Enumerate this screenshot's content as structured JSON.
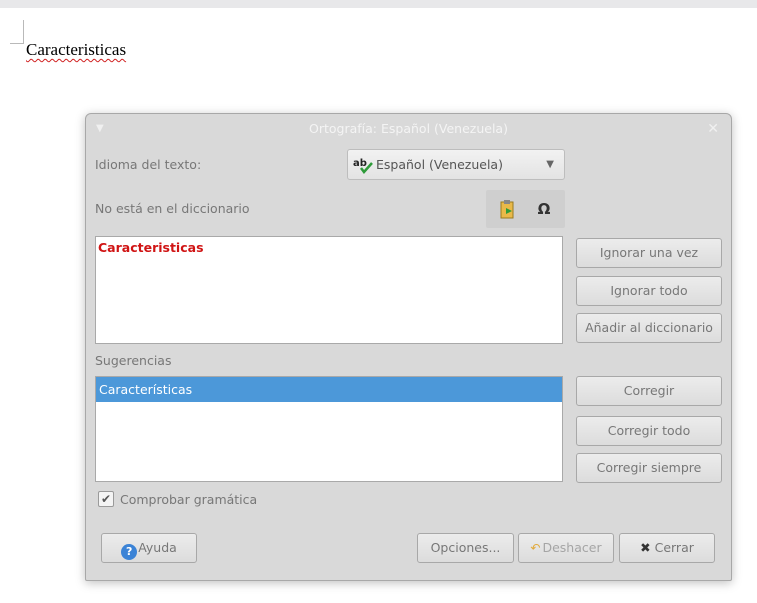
{
  "document": {
    "word": "Caracteristicas"
  },
  "dialog": {
    "title": "Ortografía: Español (Venezuela)",
    "language_label": "Idioma del texto:",
    "language_value": "Español (Venezuela)",
    "not_in_dict_label": "No está en el diccionario",
    "misspelled_word": "Caracteristicas",
    "suggestions_label": "Sugerencias",
    "suggestions": [
      "Características"
    ],
    "buttons": {
      "ignore_once": "Ignorar una vez",
      "ignore_all": "Ignorar todo",
      "add_dict": "Añadir al diccionario",
      "correct": "Corregir",
      "correct_all": "Corregir todo",
      "correct_always": "Corregir siempre",
      "help": "Ayuda",
      "options": "Opciones...",
      "undo": "Deshacer",
      "close": "Cerrar"
    },
    "check_grammar_label": "Comprobar gramática",
    "check_grammar_checked": true,
    "icons": [
      "menu-icon",
      "close-icon",
      "spellcheck-ab-icon",
      "dropdown-arrow-icon",
      "autocorrect-icon",
      "special-character-icon",
      "help-icon",
      "undo-icon",
      "x-icon",
      "checkmark-icon"
    ]
  }
}
